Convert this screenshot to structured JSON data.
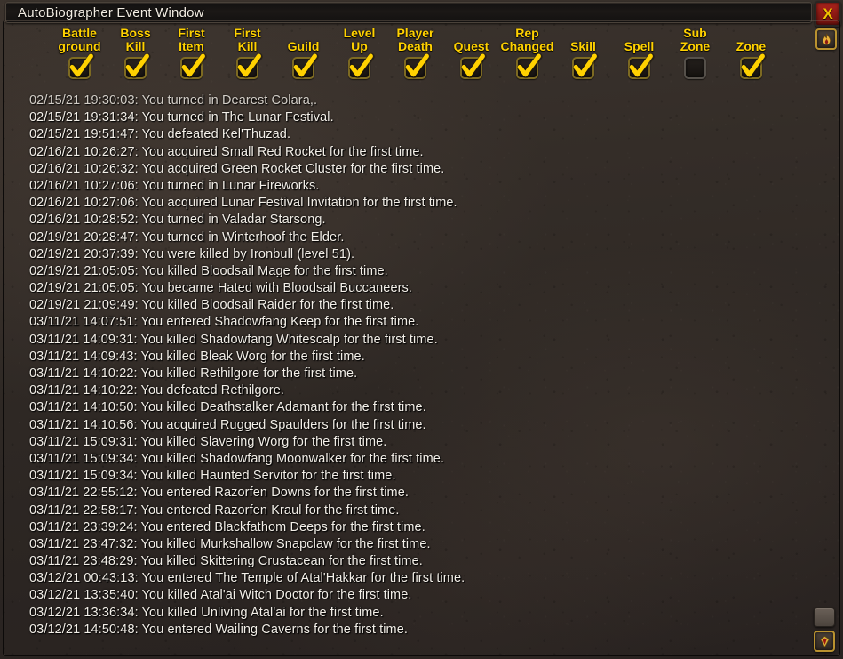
{
  "window": {
    "title": "AutoBiographer Event Window",
    "close_label": "X",
    "accent_gold": "#ffd100",
    "text_color": "#f3efe8",
    "close_color": "#8e1a14"
  },
  "corner_icons": {
    "flame": "flame-icon",
    "gem": "gem-icon",
    "resize": "resize-grip"
  },
  "toolbar": {
    "filters": [
      {
        "label": "Battle\nground",
        "name": "battleground",
        "checked": true
      },
      {
        "label": "Boss\nKill",
        "name": "boss-kill",
        "checked": true
      },
      {
        "label": "First\nItem",
        "name": "first-item",
        "checked": true
      },
      {
        "label": "First\nKill",
        "name": "first-kill",
        "checked": true
      },
      {
        "label": "Guild",
        "name": "guild",
        "checked": true
      },
      {
        "label": "Level\nUp",
        "name": "level-up",
        "checked": true
      },
      {
        "label": "Player\nDeath",
        "name": "player-death",
        "checked": true
      },
      {
        "label": "Quest",
        "name": "quest",
        "checked": true
      },
      {
        "label": "Rep\nChanged",
        "name": "rep-changed",
        "checked": true
      },
      {
        "label": "Skill",
        "name": "skill",
        "checked": true
      },
      {
        "label": "Spell",
        "name": "spell",
        "checked": true
      },
      {
        "label": "Sub\nZone",
        "name": "sub-zone",
        "checked": false
      },
      {
        "label": "Zone",
        "name": "zone",
        "checked": true
      }
    ]
  },
  "log": {
    "lines": [
      {
        "text": "02/15/21 19:30:03: You turned in Dearest Colara,.",
        "clipped": true
      },
      {
        "text": "02/15/21 19:31:34: You turned in The Lunar Festival.",
        "clipped": false
      },
      {
        "text": "02/15/21 19:51:47: You defeated Kel'Thuzad.",
        "clipped": false
      },
      {
        "text": "02/16/21 10:26:27: You acquired Small Red Rocket for the first time.",
        "clipped": false
      },
      {
        "text": "02/16/21 10:26:32: You acquired Green Rocket Cluster for the first time.",
        "clipped": false
      },
      {
        "text": "02/16/21 10:27:06: You turned in Lunar Fireworks.",
        "clipped": false
      },
      {
        "text": "02/16/21 10:27:06: You acquired Lunar Festival Invitation for the first time.",
        "clipped": false
      },
      {
        "text": "02/16/21 10:28:52: You turned in Valadar Starsong.",
        "clipped": false
      },
      {
        "text": "02/19/21 20:28:47: You turned in Winterhoof the Elder.",
        "clipped": false
      },
      {
        "text": "02/19/21 20:37:39: You were killed by Ironbull (level 51).",
        "clipped": false
      },
      {
        "text": "02/19/21 21:05:05: You killed Bloodsail Mage for the first time.",
        "clipped": false
      },
      {
        "text": "02/19/21 21:05:05: You became Hated with Bloodsail Buccaneers.",
        "clipped": false
      },
      {
        "text": "02/19/21 21:09:49: You killed Bloodsail Raider for the first time.",
        "clipped": false
      },
      {
        "text": "03/11/21 14:07:51: You entered Shadowfang Keep for the first time.",
        "clipped": false
      },
      {
        "text": "03/11/21 14:09:31: You killed Shadowfang Whitescalp for the first time.",
        "clipped": false
      },
      {
        "text": "03/11/21 14:09:43: You killed Bleak Worg for the first time.",
        "clipped": false
      },
      {
        "text": "03/11/21 14:10:22: You killed Rethilgore for the first time.",
        "clipped": false
      },
      {
        "text": "03/11/21 14:10:22: You defeated Rethilgore.",
        "clipped": false
      },
      {
        "text": "03/11/21 14:10:50: You killed Deathstalker Adamant for the first time.",
        "clipped": false
      },
      {
        "text": "03/11/21 14:10:56: You acquired Rugged Spaulders for the first time.",
        "clipped": false
      },
      {
        "text": "03/11/21 15:09:31: You killed Slavering Worg for the first time.",
        "clipped": false
      },
      {
        "text": "03/11/21 15:09:34: You killed Shadowfang Moonwalker for the first time.",
        "clipped": false
      },
      {
        "text": "03/11/21 15:09:34: You killed Haunted Servitor for the first time.",
        "clipped": false
      },
      {
        "text": "03/11/21 22:55:12: You entered Razorfen Downs for the first time.",
        "clipped": false
      },
      {
        "text": "03/11/21 22:58:17: You entered Razorfen Kraul for the first time.",
        "clipped": false
      },
      {
        "text": "03/11/21 23:39:24: You entered Blackfathom Deeps for the first time.",
        "clipped": false
      },
      {
        "text": "03/11/21 23:47:32: You killed Murkshallow Snapclaw for the first time.",
        "clipped": false
      },
      {
        "text": "03/11/21 23:48:29: You killed Skittering Crustacean for the first time.",
        "clipped": false
      },
      {
        "text": "03/12/21 00:43:13: You entered The Temple of Atal'Hakkar for the first time.",
        "clipped": false
      },
      {
        "text": "03/12/21 13:35:40: You killed Atal'ai Witch Doctor for the first time.",
        "clipped": false
      },
      {
        "text": "03/12/21 13:36:34: You killed Unliving Atal'ai for the first time.",
        "clipped": false
      },
      {
        "text": "03/12/21 14:50:48: You entered Wailing Caverns for the first time.",
        "clipped": false
      }
    ]
  }
}
